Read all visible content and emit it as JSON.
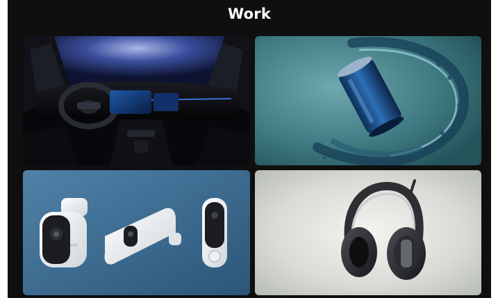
{
  "page": {
    "title": "Work"
  },
  "gallery": {
    "items": [
      {
        "subject": "car-interior-dashboard"
      },
      {
        "subject": "blue-can-water-splash"
      },
      {
        "subject": "security-cameras-and-doorbell",
        "brand_mark": "arlo"
      },
      {
        "subject": "gaming-headset"
      }
    ]
  },
  "colors": {
    "frame_bg": "#0f0f10",
    "title_text": "#ffffff",
    "teal_bg": "#3f7b82",
    "steel_blue_bg": "#3f6f94",
    "silver_bg": "#e6e7e4"
  }
}
